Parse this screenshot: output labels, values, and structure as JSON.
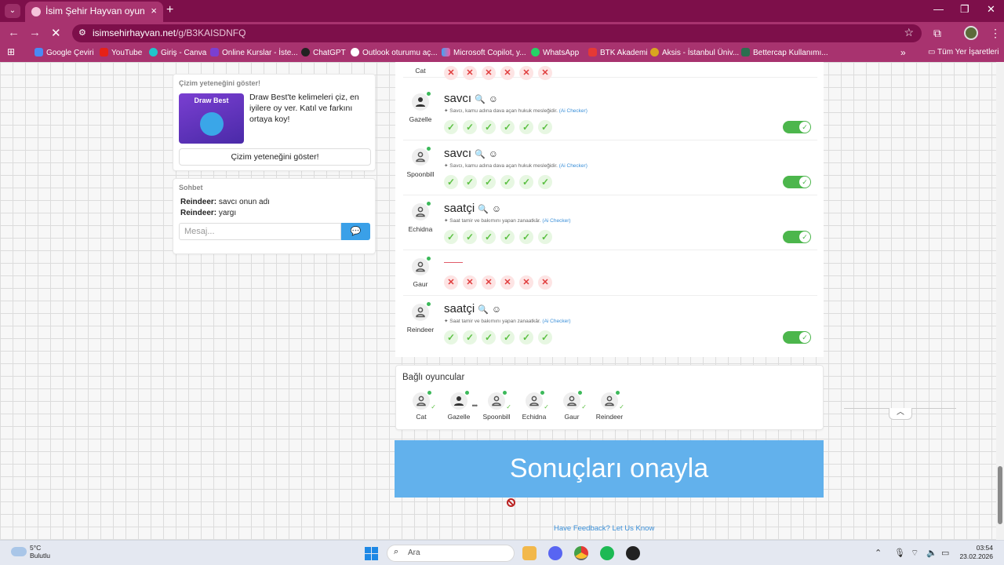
{
  "browser": {
    "tab_title": "İsim Şehir Hayvan oyununa katıl",
    "url_host": "isimsehirhayvan.net",
    "url_path": "/g/B3KAISDNFQ",
    "bookmarks": [
      "Google Çeviri",
      "YouTube",
      "Giriş - Canva",
      "Online Kurslar - İste...",
      "ChatGPT",
      "Outlook oturumu aç...",
      "Microsoft Copilot, y...",
      "WhatsApp",
      "BTK Akademi",
      "Aksis - İstanbul Üniv...",
      "Bettercap Kullanımı..."
    ],
    "all_bookmarks": "Tüm Yer İşaretleri"
  },
  "promo": {
    "header": "Çizim yeteneğini göster!",
    "image_title": "Draw Best",
    "text": "Draw Best'te kelimeleri çiz, en iyilere oy ver. Katıl ve farkını ortaya koy!",
    "button": "Çizim yeteneğini göster!"
  },
  "chat": {
    "header": "Sohbet",
    "messages": [
      {
        "user": "Reindeer:",
        "text": "savcı onun adı"
      },
      {
        "user": "Reindeer:",
        "text": "yargı"
      }
    ],
    "placeholder": "Mesaj..."
  },
  "answers": [
    {
      "player": "Cat",
      "word": "",
      "hint": "",
      "ai": "",
      "marks": [
        "no",
        "no",
        "no",
        "no",
        "no",
        "no"
      ],
      "toggle": false
    },
    {
      "player": "Gazelle",
      "word": "savcı",
      "hint": "Savcı, kamu adına dava açan hukuk mesleğidir.",
      "ai": "(Ai Checker)",
      "marks": [
        "ok",
        "ok",
        "ok",
        "ok",
        "ok",
        "ok"
      ],
      "toggle": true
    },
    {
      "player": "Spoonbill",
      "word": "savcı",
      "hint": "Savcı, kamu adına dava açan hukuk mesleğidir.",
      "ai": "(Ai Checker)",
      "marks": [
        "ok",
        "ok",
        "ok",
        "ok",
        "ok",
        "ok"
      ],
      "toggle": true
    },
    {
      "player": "Echidna",
      "word": "saatçi",
      "hint": "Saat tamir ve bakımını yapan zanaatkâr.",
      "ai": "(Ai Checker)",
      "marks": [
        "ok",
        "ok",
        "ok",
        "ok",
        "ok",
        "ok"
      ],
      "toggle": true
    },
    {
      "player": "Gaur",
      "word": "",
      "hint": "",
      "ai": "",
      "marks": [
        "no",
        "no",
        "no",
        "no",
        "no",
        "no"
      ],
      "toggle": false
    },
    {
      "player": "Reindeer",
      "word": "saatçi",
      "hint": "Saat tamir ve bakımını yapan zanaatkâr.",
      "ai": "(Ai Checker)",
      "marks": [
        "ok",
        "ok",
        "ok",
        "ok",
        "ok",
        "ok"
      ],
      "toggle": true
    }
  ],
  "connected": {
    "title": "Bağlı oyuncular",
    "players": [
      "Cat",
      "Gazelle",
      "Spoonbill",
      "Echidna",
      "Gaur",
      "Reindeer"
    ]
  },
  "confirm_label": "Sonuçları onayla",
  "feedback_label": "Have Feedback? Let Us Know",
  "taskbar": {
    "temp": "5°C",
    "weather": "Bulutlu",
    "search": "Ara",
    "time": "03:54",
    "date": "23.02.2026"
  },
  "colors": {
    "chrome": "#a8336f",
    "accent_blue": "#62b1ec",
    "check_green": "#5cc043",
    "cross_red": "#e03c3c"
  }
}
